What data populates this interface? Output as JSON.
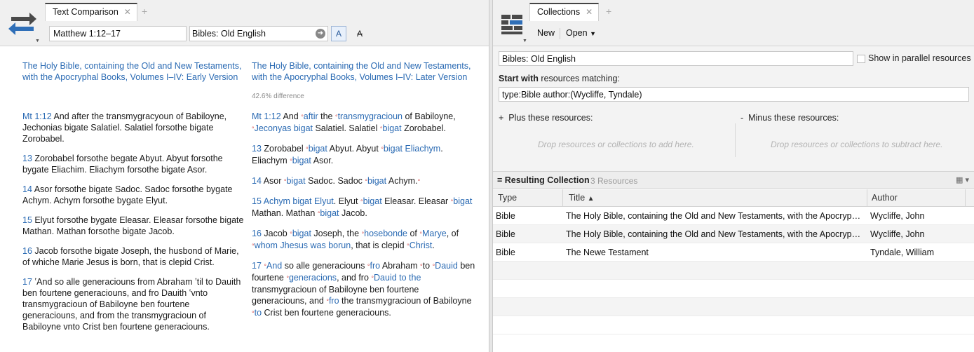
{
  "left": {
    "tab_title": "Text Comparison",
    "reference_value": "Matthew 1:12–17",
    "resources_value": "Bibles: Old English",
    "font_a_label": "A",
    "font_b_label": "A",
    "col_a": {
      "title": "The Holy Bible, containing the Old and New Testaments, with the Apocryphal Books, Volumes I–IV: Early Version"
    },
    "col_b": {
      "title": "The Holy Bible, containing the Old and New Testaments, with the Apocryphal Books, Volumes I–IV: Later Version",
      "difference": "42.6% difference"
    }
  },
  "right": {
    "tab_title": "Collections",
    "new_label": "New",
    "open_label": "Open",
    "collection_name": "Bibles: Old English",
    "parallel_label": "Show in parallel resources",
    "start_with_bold": "Start with",
    "start_with_rest": " resources matching:",
    "query": "type:Bible author:(Wycliffe, Tyndale)",
    "plus_label": "Plus these resources:",
    "minus_label": "Minus these resources:",
    "drop_add": "Drop resources or collections to add here.",
    "drop_subtract": "Drop resources or collections to subtract here.",
    "result_title": "Resulting Collection",
    "result_count": "3 Resources",
    "columns": {
      "type": "Type",
      "title": "Title",
      "author": "Author"
    },
    "rows": [
      {
        "type": "Bible",
        "title": "The Holy Bible, containing the Old and New Testaments, with the Apocryphal Books, Volumes I–IV: Early Version",
        "author": "Wycliffe, John"
      },
      {
        "type": "Bible",
        "title": "The Holy Bible, containing the Old and New Testaments, with the Apocryphal Books, Volumes I–IV: Later Version",
        "author": "Wycliffe, John"
      },
      {
        "type": "Bible",
        "title": "The Newe Testament",
        "author": "Tyndale, William"
      }
    ]
  },
  "colors": {
    "link": "#2a6ab3",
    "marker": "#d24a4a"
  }
}
